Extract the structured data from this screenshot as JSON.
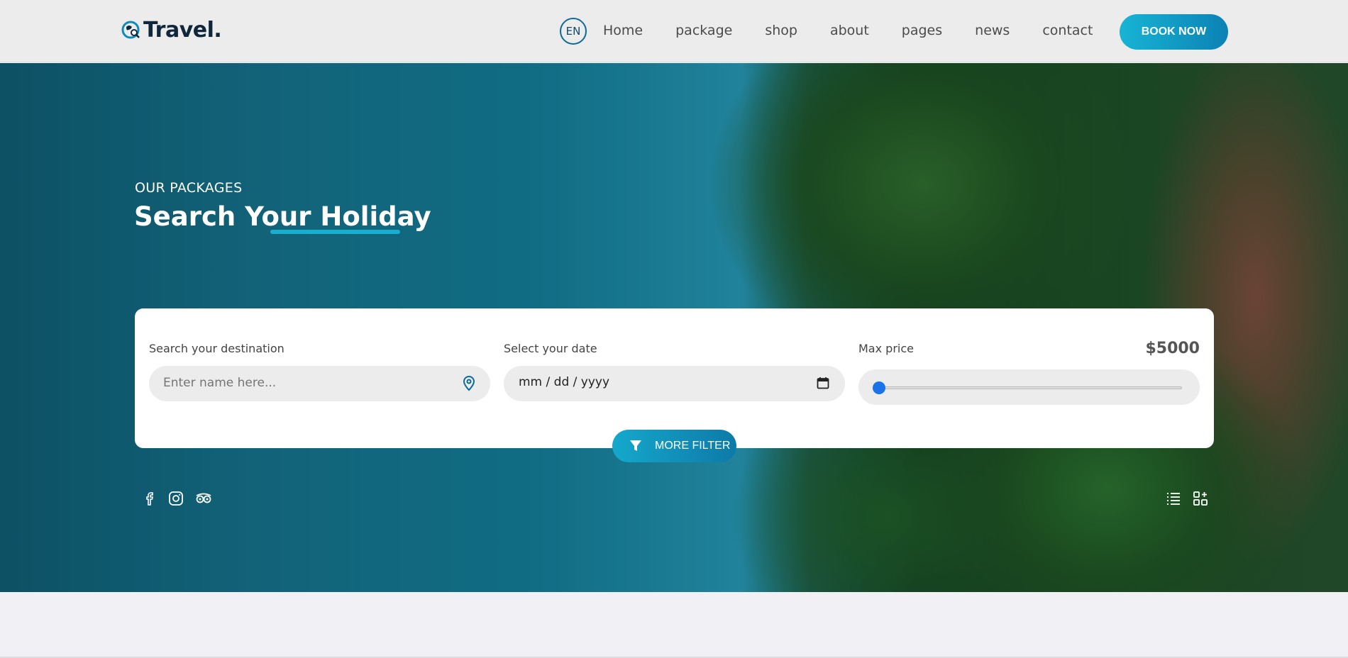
{
  "header": {
    "logo_text": "Travel.",
    "language": "EN",
    "nav": [
      "Home",
      "package",
      "shop",
      "about",
      "pages",
      "news",
      "contact"
    ],
    "book_now_label": "BOOK NOW"
  },
  "hero": {
    "kicker": "OUR PACKAGES",
    "headline": "Search Your Holiday"
  },
  "search": {
    "destination_label": "Search your destination",
    "destination_placeholder": "Enter name here...",
    "date_label": "Select your date",
    "date_value": "mm / dd / yyyy",
    "price_label": "Max price",
    "price_value": "$5000",
    "price_slider_fraction": 0.0,
    "more_filter_label": "MORE FILTER"
  },
  "icons": {
    "social": [
      "facebook-icon",
      "instagram-icon",
      "tripadvisor-icon"
    ],
    "view": [
      "list-view-icon",
      "grid-view-icon"
    ]
  },
  "colors": {
    "accent": "#18b4d4",
    "accent_dark": "#0b82b4",
    "brand_text": "#10263a"
  }
}
